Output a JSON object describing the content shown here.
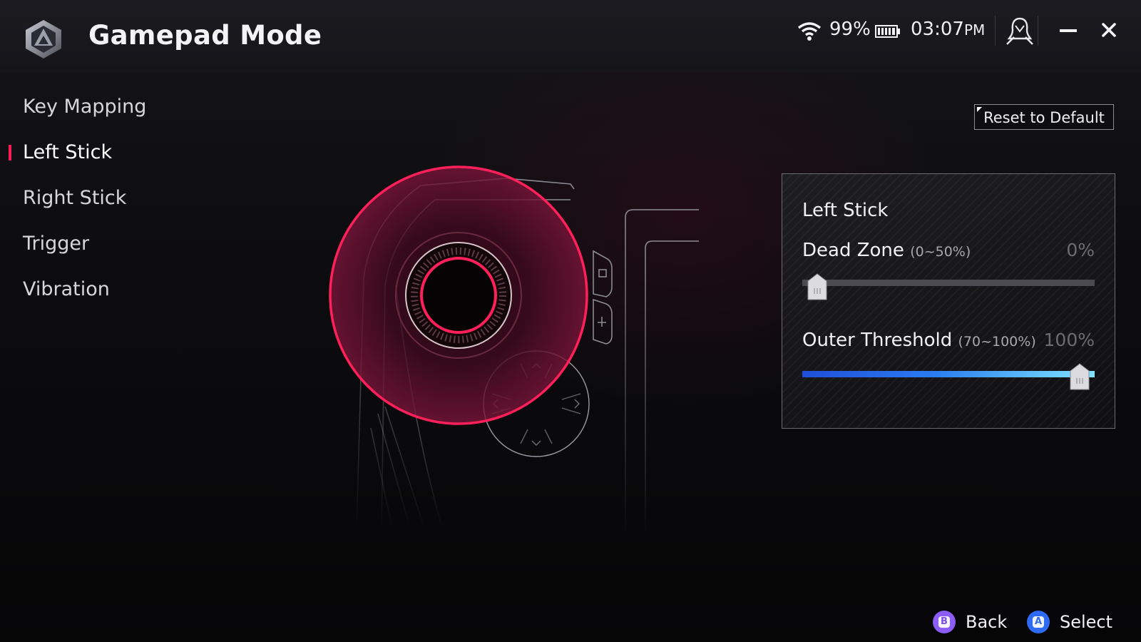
{
  "window": {
    "title": "Gamepad Mode",
    "battery_percent": "99%",
    "time": "03:07",
    "time_suffix": "PM"
  },
  "icons": {
    "logo": "armoury-crate-logo-icon",
    "wifi": "wifi-icon",
    "battery": "battery-icon",
    "user": "user-profile-icon",
    "minimize": "minimize-icon",
    "close": "close-icon"
  },
  "sidebar": {
    "items": [
      {
        "label": "Key Mapping",
        "active": false
      },
      {
        "label": "Left Stick",
        "active": true
      },
      {
        "label": "Right Stick",
        "active": false
      },
      {
        "label": "Trigger",
        "active": false
      },
      {
        "label": "Vibration",
        "active": false
      }
    ]
  },
  "toolbar": {
    "reset_label": "Reset to Default"
  },
  "panel": {
    "title": "Left Stick",
    "dead_zone": {
      "label": "Dead Zone",
      "range": "(0~50%)",
      "value_text": "0%",
      "min": 0,
      "max": 50,
      "value": 0
    },
    "outer_threshold": {
      "label": "Outer Threshold",
      "range": "(70~100%)",
      "value_text": "100%",
      "min": 70,
      "max": 100,
      "value": 100
    }
  },
  "footer": {
    "back_label": "Back",
    "select_label": "Select",
    "back_button_glyph": "B",
    "select_button_glyph": "A"
  },
  "colors": {
    "accent": "#ff1a55",
    "highlight_ring": "#ff1f5a",
    "slider_fill_start": "#1f4fd8",
    "slider_fill_end": "#7fe6ff",
    "back_button": "#8b5cf6",
    "select_button": "#2f6bf2"
  }
}
